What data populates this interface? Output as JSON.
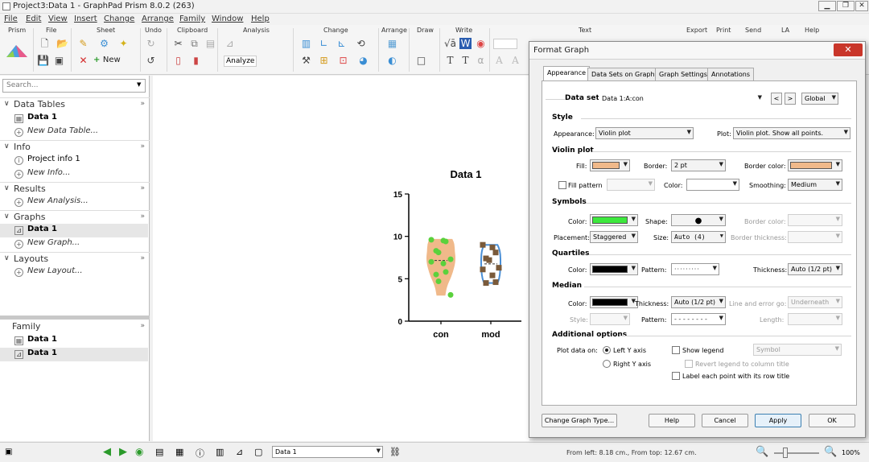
{
  "window": {
    "title": "Project3:Data 1 - GraphPad Prism 8.0.2 (263)"
  },
  "menu": [
    "File",
    "Edit",
    "View",
    "Insert",
    "Change",
    "Arrange",
    "Family",
    "Window",
    "Help"
  ],
  "ribbon": {
    "groups": [
      "Prism",
      "File",
      "Sheet",
      "Undo",
      "Clipboard",
      "Analysis",
      "Change",
      "Arrange",
      "Draw",
      "Write",
      "Text",
      "Export",
      "Print",
      "Send",
      "LA",
      "Help"
    ],
    "new_label": "New",
    "analyze_label": "Analyze"
  },
  "sidebar": {
    "search_placeholder": "Search...",
    "sections": [
      {
        "label": "Data Tables",
        "items": [
          "Data 1",
          "New Data Table..."
        ]
      },
      {
        "label": "Info",
        "items": [
          "Project info 1",
          "New Info..."
        ]
      },
      {
        "label": "Results",
        "items": [
          "New Analysis..."
        ]
      },
      {
        "label": "Graphs",
        "items": [
          "Data 1",
          "New Graph..."
        ]
      },
      {
        "label": "Layouts",
        "items": [
          "New Layout..."
        ]
      }
    ],
    "family": {
      "label": "Family",
      "items": [
        "Data 1",
        "Data 1"
      ]
    }
  },
  "graph": {
    "title": "Data 1",
    "yticks": [
      "15",
      "10",
      "5",
      "0"
    ],
    "xlabels": [
      "con",
      "mod"
    ],
    "colors": {
      "con_fill": "#f0b98a",
      "con_points": "#5ad13c",
      "mod_border": "#4a8fd6",
      "mod_points": "#7a5a3a"
    }
  },
  "chart_data": {
    "type": "violin",
    "title": "Data 1",
    "categories": [
      "con",
      "mod"
    ],
    "ylim": [
      0,
      15
    ],
    "yticks": [
      0,
      5,
      10,
      15
    ],
    "series": [
      {
        "name": "con",
        "values": [
          9.6,
          9.5,
          9.4,
          8.3,
          8.1,
          7.3,
          7.0,
          6.8,
          5.8,
          5.5,
          4.7,
          3.1
        ]
      },
      {
        "name": "mod",
        "values": [
          9.0,
          8.7,
          8.1,
          7.4,
          7.2,
          6.3,
          6.1,
          5.4,
          4.6,
          4.5
        ]
      }
    ]
  },
  "dialog": {
    "title": "Format Graph",
    "tabs": [
      "Appearance",
      "Data Sets on Graph",
      "Graph Settings",
      "Annotations"
    ],
    "dataset_label": "Data set:",
    "dataset_value": "Data 1:A:con",
    "nav_prev": "<",
    "nav_next": ">",
    "scope": "Global",
    "style": {
      "heading": "Style",
      "appearance_label": "Appearance:",
      "appearance_value": "Violin plot",
      "plot_label": "Plot:",
      "plot_value": "Violin plot. Show all points."
    },
    "violin": {
      "heading": "Violin plot",
      "fill_label": "Fill:",
      "fill_color": "#f0b98a",
      "border_label": "Border:",
      "border_value": "2 pt",
      "border_color_label": "Border color:",
      "border_color": "#f0b98a",
      "fill_pattern_label": "Fill pattern",
      "color_label": "Color:",
      "smoothing_label": "Smoothing:",
      "smoothing_value": "Medium"
    },
    "symbols": {
      "heading": "Symbols",
      "color_label": "Color:",
      "color": "#3de83d",
      "shape_label": "Shape:",
      "shape_symbol": "●",
      "border_color_label": "Border color:",
      "placement_label": "Placement:",
      "placement_value": "Staggered",
      "size_label": "Size:",
      "size_value": "Auto (4)",
      "border_thickness_label": "Border thickness:"
    },
    "quartiles": {
      "heading": "Quartiles",
      "color_label": "Color:",
      "color": "#000000",
      "pattern_label": "Pattern:",
      "thickness_label": "Thickness:",
      "thickness_value": "Auto (1/2 pt)"
    },
    "median": {
      "heading": "Median",
      "color_label": "Color:",
      "color": "#000000",
      "thickness_label": "Thickness:",
      "thickness_value": "Auto (1/2 pt)",
      "line_error_label": "Line and error go:",
      "line_error_value": "Underneath",
      "style_label": "Style:",
      "pattern_label": "Pattern:",
      "length_label": "Length:"
    },
    "additional": {
      "heading": "Additional options",
      "plot_on_label": "Plot data on:",
      "left_axis": "Left Y axis",
      "right_axis": "Right  Y axis",
      "show_legend": "Show legend",
      "legend_style": "Symbol",
      "revert_legend": "Revert legend to column title",
      "label_points": "Label each point with its row title"
    },
    "buttons": {
      "change_type": "Change Graph Type...",
      "help": "Help",
      "cancel": "Cancel",
      "apply": "Apply",
      "ok": "OK"
    }
  },
  "statusbar": {
    "sheet_value": "Data 1",
    "position": "From left: 8.18 cm., From top: 12.67 cm.",
    "zoom": "100%"
  }
}
